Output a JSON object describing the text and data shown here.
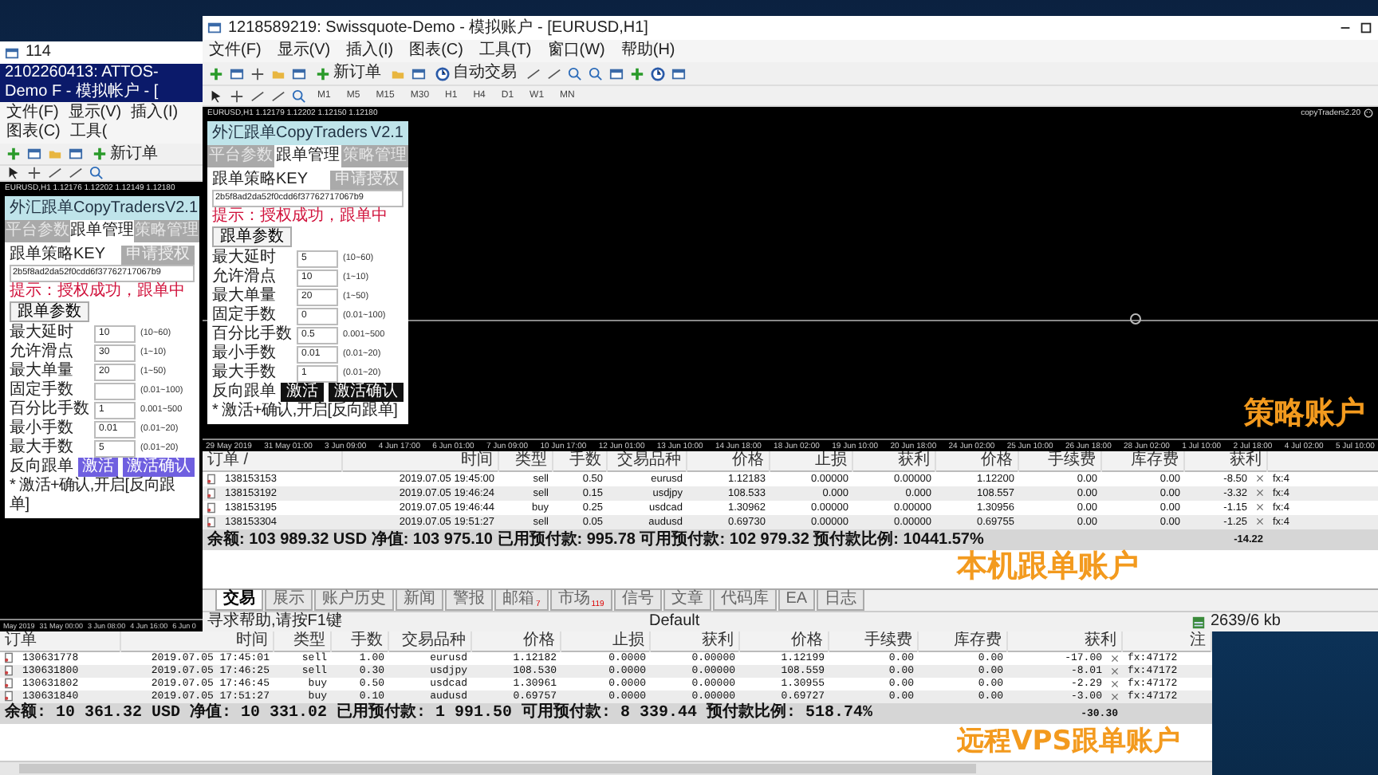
{
  "third_window": {
    "title": "114"
  },
  "back_window": {
    "title": "2102260413: ATTOS-Demo F - 模拟帐户 - [",
    "menu": [
      "文件(F)",
      "显示(V)",
      "插入(I)",
      "图表(C)",
      "工具("
    ],
    "toolbar_button": "新订单",
    "chart_header": "EURUSD,H1  1.12176 1.12202 1.12149 1.12180",
    "panel": {
      "title": "外汇跟单CopyTraders",
      "version": "V2.1",
      "tabs": [
        {
          "label": "平台参数",
          "selected": false
        },
        {
          "label": "跟单管理",
          "selected": true
        },
        {
          "label": "策略管理",
          "selected": false
        }
      ],
      "key_label": "跟单策略KEY",
      "auth_button": "申请授权",
      "key": "2b5f8ad2da52f0cdd6f37762717067b9",
      "tip": "提示：授权成功，跟单中",
      "params_button": "跟单参数",
      "params": [
        {
          "label": "最大延时",
          "value": "10",
          "range": "(10~60)"
        },
        {
          "label": "允许滑点",
          "value": "30",
          "range": "(1~10)"
        },
        {
          "label": "最大单量",
          "value": "20",
          "range": "(1~50)"
        },
        {
          "label": "固定手数",
          "range": "(0.01~100)"
        },
        {
          "label": "百分比手数",
          "value": "1",
          "range": "0.001~500"
        },
        {
          "label": "最小手数",
          "value": "0.01",
          "range": "(0.01~20)"
        },
        {
          "label": "最大手数",
          "value": "5",
          "range": "(0.01~20)"
        }
      ],
      "reverse_label": "反向跟单",
      "buttons": [
        "激活",
        "激活确认"
      ],
      "buttons_highlighted": true,
      "note": "* 激活+确认,开启[反向跟单]"
    },
    "axis_labels": [
      "May 2019",
      "31 May 00:00",
      "3 Jun 08:00",
      "4 Jun 16:00",
      "6 Jun 0"
    ]
  },
  "front_window": {
    "title": "1218589219: Swissquote-Demo - 模拟账户 - [EURUSD,H1]",
    "menu": [
      "文件(F)",
      "显示(V)",
      "插入(I)",
      "图表(C)",
      "工具(T)",
      "窗口(W)",
      "帮助(H)"
    ],
    "new_order_button": "新订单",
    "auto_trade_button": "自动交易",
    "periods": [
      "M1",
      "M5",
      "M15",
      "M30",
      "H1",
      "H4",
      "D1",
      "W1",
      "MN"
    ],
    "chart_header": "EURUSD,H1  1.12179 1.12202 1.12150 1.12180",
    "expert_label": "copyTraders2.20",
    "panel": {
      "title": "外汇跟单CopyTraders",
      "version": "V2.1",
      "tabs": [
        {
          "label": "平台参数",
          "selected": false
        },
        {
          "label": "跟单管理",
          "selected": true
        },
        {
          "label": "策略管理",
          "selected": false
        }
      ],
      "key_label": "跟单策略KEY",
      "auth_button": "申请授权",
      "key": "2b5f8ad2da52f0cdd6f37762717067b9",
      "tip": "提示：授权成功，跟单中",
      "params_button": "跟单参数",
      "params": [
        {
          "label": "最大延时",
          "value": "5",
          "range": "(10~60)"
        },
        {
          "label": "允许滑点",
          "value": "10",
          "range": "(1~10)"
        },
        {
          "label": "最大单量",
          "value": "20",
          "range": "(1~50)"
        },
        {
          "label": "固定手数",
          "value": "0",
          "range": "(0.01~100)"
        },
        {
          "label": "百分比手数",
          "value": "0.5",
          "range": "0.001~500"
        },
        {
          "label": "最小手数",
          "value": "0.01",
          "range": "(0.01~20)"
        },
        {
          "label": "最大手数",
          "value": "1",
          "range": "(0.01~20)"
        }
      ],
      "reverse_label": "反向跟单",
      "buttons": [
        "激活",
        "激活确认"
      ],
      "buttons_highlighted": false,
      "note": "* 激活+确认,开启[反向跟单]"
    },
    "chart_caption": "策略账户",
    "axis_labels": [
      "29 May 2019",
      "31 May 01:00",
      "3 Jun 09:00",
      "4 Jun 17:00",
      "6 Jun 01:00",
      "7 Jun 09:00",
      "10 Jun 17:00",
      "12 Jun 01:00",
      "13 Jun 10:00",
      "14 Jun 18:00",
      "18 Jun 02:00",
      "19 Jun 10:00",
      "20 Jun 18:00",
      "24 Jun 02:00",
      "25 Jun 10:00",
      "26 Jun 18:00",
      "28 Jun 02:00",
      "1 Jul 10:00",
      "2 Jul 18:00",
      "4 Jul 02:00",
      "5 Jul 10:00"
    ],
    "table": {
      "columns": [
        "订单 /",
        "时间",
        "类型",
        "手数",
        "交易品种",
        "价格",
        "止损",
        "获利",
        "价格",
        "手续费",
        "库存费",
        "获利"
      ],
      "rows": [
        [
          "138153153",
          "2019.07.05 19:45:00",
          "sell",
          "0.50",
          "eurusd",
          "1.12183",
          "0.00000",
          "0.00000",
          "1.12200",
          "0.00",
          "0.00",
          "-8.50",
          "fx:4"
        ],
        [
          "138153192",
          "2019.07.05 19:46:24",
          "sell",
          "0.15",
          "usdjpy",
          "108.533",
          "0.000",
          "0.000",
          "108.557",
          "0.00",
          "0.00",
          "-3.32",
          "fx:4"
        ],
        [
          "138153195",
          "2019.07.05 19:46:44",
          "buy",
          "0.25",
          "usdcad",
          "1.30962",
          "0.00000",
          "0.00000",
          "1.30956",
          "0.00",
          "0.00",
          "-1.15",
          "fx:4"
        ],
        [
          "138153304",
          "2019.07.05 19:51:27",
          "sell",
          "0.05",
          "audusd",
          "0.69730",
          "0.00000",
          "0.00000",
          "0.69755",
          "0.00",
          "0.00",
          "-1.25",
          "fx:4"
        ]
      ],
      "summary": "余额: 103 989.32 USD  净值: 103 975.10  已用预付款: 995.78  可用预付款: 102 979.32  预付款比例: 10441.57%",
      "total": "-14.22"
    },
    "table_caption": "本机跟单账户",
    "tabs": [
      {
        "label": "交易",
        "selected": true
      },
      {
        "label": "展示",
        "selected": false
      },
      {
        "label": "账户历史",
        "selected": false
      },
      {
        "label": "新闻",
        "selected": false
      },
      {
        "label": "警报",
        "selected": false
      },
      {
        "label": "邮箱",
        "badge": "7",
        "selected": false
      },
      {
        "label": "市场",
        "badge": "119",
        "selected": false
      },
      {
        "label": "信号",
        "selected": false
      },
      {
        "label": "文章",
        "selected": false
      },
      {
        "label": "代码库",
        "selected": false
      },
      {
        "label": "EA",
        "selected": false
      },
      {
        "label": "日志",
        "selected": false
      }
    ],
    "status": {
      "help": "寻求帮助,请按F1键",
      "profile": "Default",
      "traffic": "2639/6 kb"
    }
  },
  "bottom_window": {
    "table": {
      "columns": [
        "订单",
        "时间",
        "类型",
        "手数",
        "交易品种",
        "价格",
        "止损",
        "获利",
        "价格",
        "手续费",
        "库存费",
        "获利",
        "注"
      ],
      "rows": [
        [
          "130631778",
          "2019.07.05 17:45:01",
          "sell",
          "1.00",
          "eurusd",
          "1.12182",
          "0.0000",
          "0.00000",
          "1.12199",
          "0.00",
          "0.00",
          "-17.00",
          "fx:47172"
        ],
        [
          "130631800",
          "2019.07.05 17:46:25",
          "sell",
          "0.30",
          "usdjpy",
          "108.530",
          "0.0000",
          "0.00000",
          "108.559",
          "0.00",
          "0.00",
          "-8.01",
          "fx:47172"
        ],
        [
          "130631802",
          "2019.07.05 17:46:45",
          "buy",
          "0.50",
          "usdcad",
          "1.30961",
          "0.0000",
          "0.00000",
          "1.30955",
          "0.00",
          "0.00",
          "-2.29",
          "fx:47172"
        ],
        [
          "130631840",
          "2019.07.05 17:51:27",
          "buy",
          "0.10",
          "audusd",
          "0.69757",
          "0.0000",
          "0.00000",
          "0.69727",
          "0.00",
          "0.00",
          "-3.00",
          "fx:47172"
        ]
      ],
      "summary": "余额: 10 361.32 USD  净值: 10 331.02  已用预付款: 1 991.50  可用预付款: 8 339.44  预付款比例: 518.74%",
      "total": "-30.30"
    },
    "caption": "远程VPS跟单账户"
  }
}
